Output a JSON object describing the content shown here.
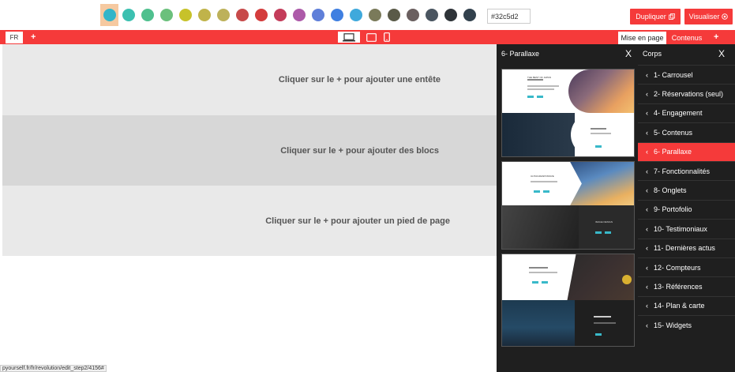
{
  "toolbar": {
    "swatches": [
      "#33b5c9",
      "#3cc0b0",
      "#4fc08e",
      "#6bc07c",
      "#c7c22a",
      "#c0b34a",
      "#bdb15a",
      "#c74a4a",
      "#d43c3c",
      "#c43c5a",
      "#ad5aa9",
      "#5f7fd9",
      "#3f7fe1",
      "#3fa9dc",
      "#7a7a5a",
      "#5a5a48",
      "#6a5f5f",
      "#4a5560",
      "#2e3338",
      "#32414d"
    ],
    "hex_value": "#32c5d2",
    "duplicate_label": "Dupliquer",
    "visualize_label": "Visualiser"
  },
  "redbar": {
    "lang": "FR",
    "plus": "+",
    "tab_layout": "Mise en page",
    "tab_content": "Contenus",
    "plus_right": "+"
  },
  "canvas": {
    "header_hint": "Cliquer sur le + pour ajouter une entête",
    "blocks_hint": "Cliquer sur le + pour ajouter des blocs",
    "footer_hint": "Cliquer sur le + pour ajouter un pied de page"
  },
  "preview_panel": {
    "title": "6- Parallaxe",
    "close": "X",
    "thumb_texts": {
      "t1": "THE BEST OF JAPAN",
      "t2": "ULTRA RESPONSIVE",
      "t3": "IMAGE DESIGN"
    }
  },
  "corps_panel": {
    "title": "Corps",
    "close": "X",
    "items": [
      {
        "label": "1- Carrousel"
      },
      {
        "label": "2- Réservations (seul)"
      },
      {
        "label": "4- Engagement"
      },
      {
        "label": "5- Contenus"
      },
      {
        "label": "6- Parallaxe"
      },
      {
        "label": "7- Fonctionnalités"
      },
      {
        "label": "8- Onglets"
      },
      {
        "label": "9- Portofolio"
      },
      {
        "label": "10- Testimoniaux"
      },
      {
        "label": "11- Dernières actus"
      },
      {
        "label": "12- Compteurs"
      },
      {
        "label": "13- Références"
      },
      {
        "label": "14- Plan & carte"
      },
      {
        "label": "15- Widgets"
      }
    ],
    "active_index": 4
  },
  "status_url": "pyourself.fr/fr/revolution/edit_step2/4156#"
}
